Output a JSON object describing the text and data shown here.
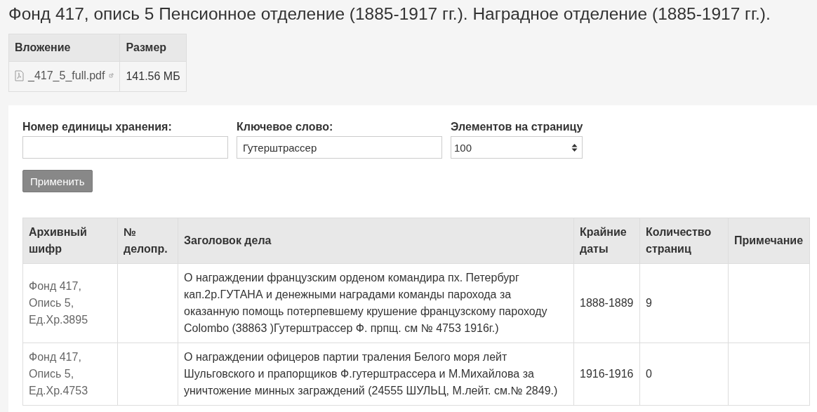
{
  "title": "Фонд 417, опись 5 Пенсионное отделение (1885-1917 гг.). Наградное отделение (1885-1917 гг.).",
  "attachments": {
    "columns": [
      "Вложение",
      "Размер"
    ],
    "rows": [
      {
        "file": "_417_5_full.pdf",
        "size": "141.56 МБ"
      }
    ]
  },
  "filters": [
    {
      "label": "Номер единицы хранения:",
      "kind": "text"
    },
    {
      "label": "Ключевое слово:",
      "kind": "text",
      "value": "Гутерштрассер"
    },
    {
      "label": "Элементов на страницу",
      "kind": "select",
      "value": "100"
    }
  ],
  "apply_button": "Применить",
  "table": {
    "columns": [
      "Архивный шифр",
      "№ делопр.",
      "Заголовок дела",
      "Крайние даты",
      "Количество страниц",
      "Примечание"
    ],
    "rows": [
      {
        "cipher": [
          "Фонд 417,",
          "Опись 5,",
          "Ед.Хр.3895"
        ],
        "title": "О награждении французским орденом командира пх. Петербург кап.2р.ГУТАНА и денежными наградами команды парохода за оказанную помощь потерпевшему крушение французскому пароходу Colombo (38863 )Гутерштрассер Ф. прпщ. см № 4753 1916г.)",
        "dates": "1888-1889",
        "pages": "9"
      },
      {
        "cipher": [
          "Фонд 417,",
          "Опись 5,",
          "Ед.Хр.4753"
        ],
        "title": "О награждении офицеров партии траления Белого моря лейт Шульговского и прапорщиков Ф.гутерштрассера и М.Михайлова за уничтожение минных заграждений (24555 ШУЛЬЦ, М.лейт. см.№ 2849.)",
        "dates": "1916-1916",
        "pages": "0"
      }
    ]
  }
}
